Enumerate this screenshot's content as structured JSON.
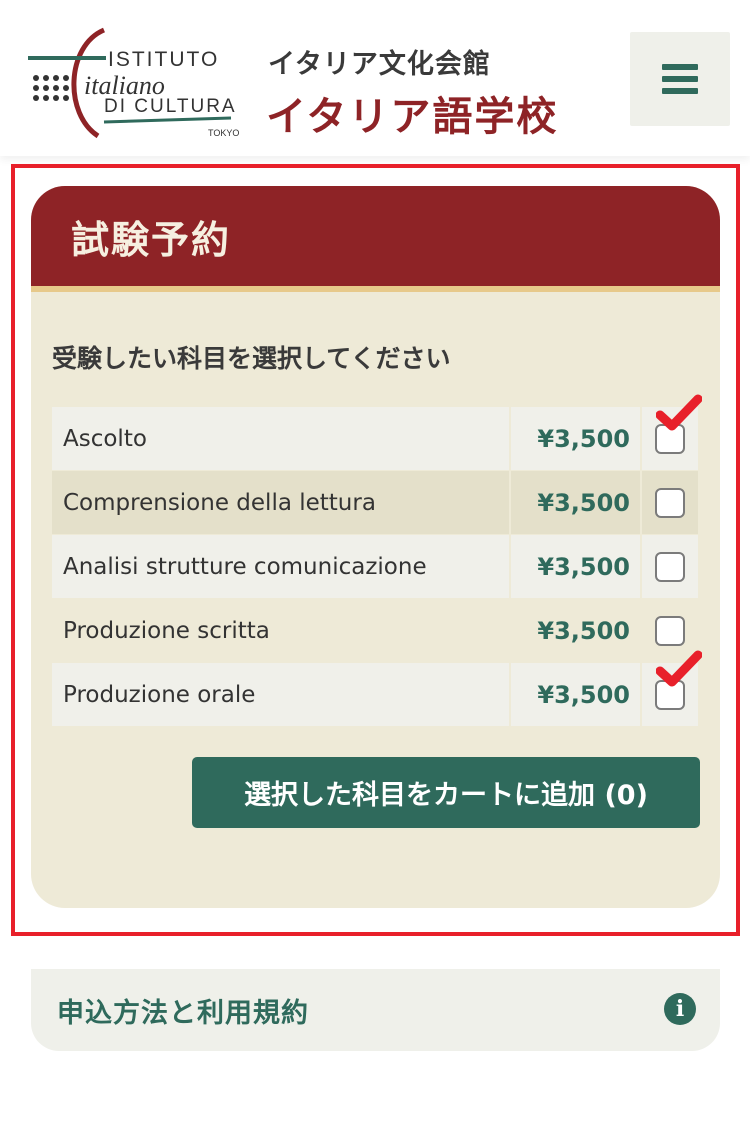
{
  "header": {
    "logo": {
      "line1": "ISTITUTO",
      "line2": "italiano",
      "line3": "DI CULTURA",
      "line4": "TOKYO"
    },
    "org_name": "イタリア文化会館",
    "school_name": "イタリア語学校",
    "menu_icon": "hamburger-menu-icon"
  },
  "exam": {
    "title": "試験予約",
    "instruction": "受験したい科目を選択してください",
    "subjects": [
      {
        "name": "Ascolto",
        "price": "¥3,500",
        "checked": false
      },
      {
        "name": "Comprensione della lettura",
        "price": "¥3,500",
        "checked": false
      },
      {
        "name": "Analisi strutture comunicazione",
        "price": "¥3,500",
        "checked": false
      },
      {
        "name": "Produzione scritta",
        "price": "¥3,500",
        "checked": false
      },
      {
        "name": "Produzione orale",
        "price": "¥3,500",
        "checked": false
      }
    ],
    "add_button_label": "選択した科目をカートに追加 (0)"
  },
  "terms": {
    "label": "申込方法と利用規約",
    "icon": "info-icon"
  },
  "colors": {
    "brand_red": "#8e2326",
    "accent_green": "#2f6a5c",
    "card_bg": "#eeead7",
    "highlight_red": "#e8202a"
  }
}
